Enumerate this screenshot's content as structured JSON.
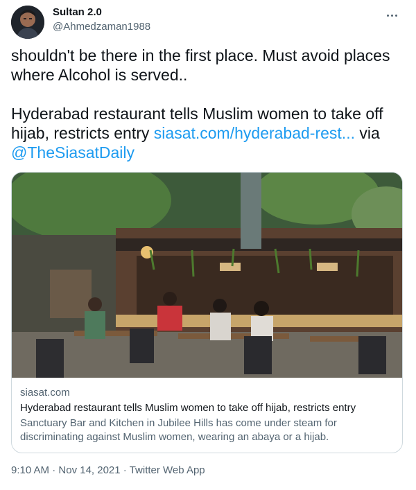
{
  "user": {
    "display_name": "Sultan 2.0",
    "handle": "@Ahmedzaman1988"
  },
  "tweet": {
    "text_line1": "shouldn't be there in the first place. Must avoid places where Alcohol is served..",
    "text_line2": "Hyderabad restaurant tells Muslim women to take off hijab, restricts entry ",
    "link_text": "siasat.com/hyderabad-rest...",
    "via_text": " via ",
    "mention": "@TheSiasatDaily"
  },
  "card": {
    "domain": "siasat.com",
    "title": "Hyderabad restaurant tells Muslim women to take off hijab, restricts entry",
    "description": "Sanctuary Bar and Kitchen in Jubilee Hills has come under steam for discriminating against Muslim women, wearing an abaya or a hijab."
  },
  "meta": {
    "time": "9:10 AM",
    "separator": " · ",
    "date": "Nov 14, 2021",
    "source": "Twitter Web App"
  },
  "colors": {
    "link": "#1d9bf0",
    "secondary_text": "#536471",
    "border": "#cfd9de"
  },
  "icons": {
    "more": "more-horizontal-icon"
  }
}
